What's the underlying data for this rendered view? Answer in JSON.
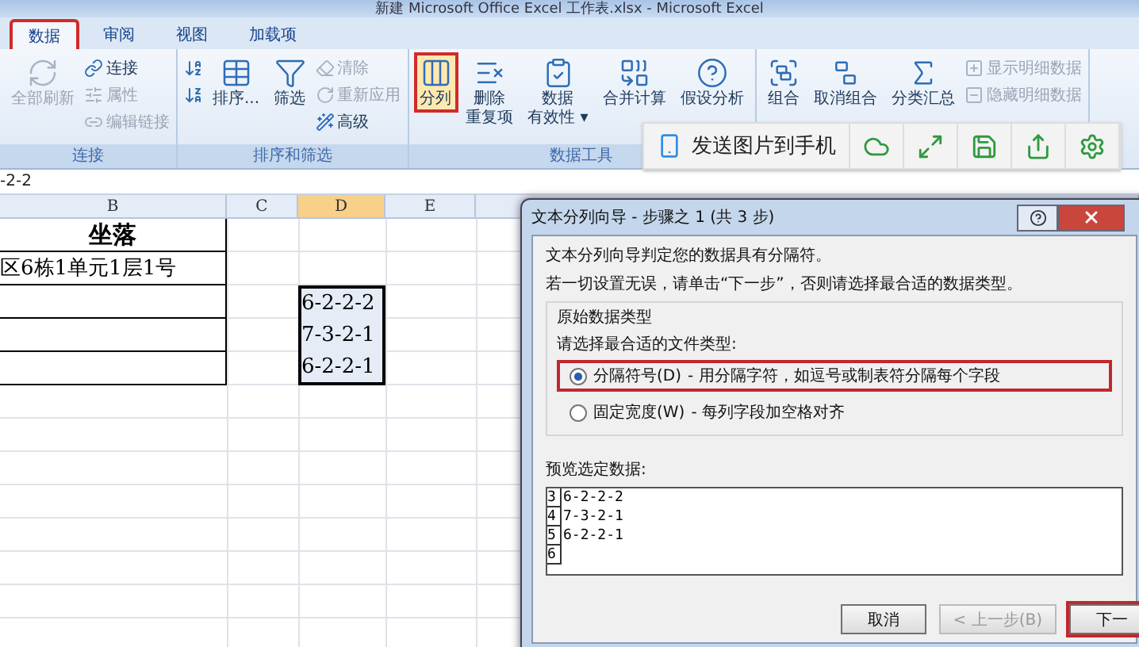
{
  "window": {
    "title": "新建 Microsoft Office Excel 工作表.xlsx - Microsoft Excel"
  },
  "ribbon_tabs": [
    {
      "label": "数据",
      "selected": true,
      "highlighted": true
    },
    {
      "label": "审阅",
      "selected": false,
      "highlighted": false
    },
    {
      "label": "视图",
      "selected": false,
      "highlighted": false
    },
    {
      "label": "加载项",
      "selected": false,
      "highlighted": false
    }
  ],
  "ribbon_groups": [
    {
      "label": "连接",
      "columns": [
        {
          "kind": "large",
          "lines": [
            "全部刷新"
          ],
          "disabled": true,
          "highlighted": false
        },
        {
          "kind": "stack",
          "items": [
            {
              "label": "连接",
              "disabled": false
            },
            {
              "label": "属性",
              "disabled": true
            },
            {
              "label": "编辑链接",
              "disabled": true
            }
          ]
        }
      ]
    },
    {
      "label": "排序和筛选",
      "columns": [
        {
          "kind": "stack",
          "items": [
            {
              "disabled": false
            },
            {
              "disabled": false
            }
          ]
        },
        {
          "kind": "large",
          "lines": [
            "排序..."
          ],
          "disabled": false,
          "highlighted": false
        },
        {
          "kind": "large",
          "lines": [
            "筛选"
          ],
          "disabled": false,
          "highlighted": false
        },
        {
          "kind": "stack",
          "items": [
            {
              "label": "清除",
              "disabled": true
            },
            {
              "label": "重新应用",
              "disabled": true
            },
            {
              "label": "高级",
              "disabled": false
            }
          ]
        }
      ]
    },
    {
      "label": "数据工具",
      "columns": [
        {
          "kind": "large",
          "lines": [
            "分列"
          ],
          "disabled": false,
          "highlighted": true
        },
        {
          "kind": "large",
          "lines": [
            "删除",
            "重复项"
          ],
          "disabled": false,
          "highlighted": false
        },
        {
          "kind": "large",
          "lines": [
            "数据",
            "有效性 ▾"
          ],
          "disabled": false,
          "highlighted": false
        },
        {
          "kind": "large",
          "lines": [
            "合并计算"
          ],
          "disabled": false,
          "highlighted": false
        },
        {
          "kind": "large",
          "lines": [
            "假设分析"
          ],
          "disabled": false,
          "highlighted": false
        }
      ]
    },
    {
      "columns": [
        {
          "kind": "large",
          "lines": [
            "组合"
          ],
          "disabled": false,
          "highlighted": false
        },
        {
          "kind": "large",
          "lines": [
            "取消组合"
          ],
          "disabled": false,
          "highlighted": false
        },
        {
          "kind": "large",
          "lines": [
            "分类汇总"
          ],
          "disabled": false,
          "highlighted": false
        },
        {
          "kind": "stack",
          "items": [
            {
              "label": "显示明细数据",
              "disabled": true
            },
            {
              "label": "隐藏明细数据",
              "disabled": true
            }
          ]
        }
      ]
    }
  ],
  "float_toolbar": {
    "label": "发送图片到手机"
  },
  "formula_bar": {
    "value": "-2-2"
  },
  "sheet": {
    "columns": [
      {
        "label": "B",
        "selected": false
      },
      {
        "label": "C",
        "selected": false
      },
      {
        "label": "D",
        "selected": true
      },
      {
        "label": "E",
        "selected": false
      }
    ],
    "rows": [
      {
        "cells": [
          {
            "text": "坐落",
            "selected": false
          },
          {
            "selected": false
          },
          {
            "selected": false
          },
          {
            "selected": false
          }
        ]
      },
      {
        "cells": [
          {
            "text": "区6栋1单元1层1号",
            "selected": false
          },
          {
            "selected": false
          },
          {
            "selected": false
          },
          {
            "selected": false
          }
        ]
      },
      {
        "cells": [
          {
            "selected": false
          },
          {
            "selected": false
          },
          {
            "text": "6-2-2-2",
            "selected": true
          },
          {
            "selected": false
          }
        ]
      },
      {
        "cells": [
          {
            "selected": false
          },
          {
            "selected": false
          },
          {
            "text": "7-3-2-1",
            "selected": true
          },
          {
            "selected": false
          }
        ]
      },
      {
        "cells": [
          {
            "selected": false
          },
          {
            "selected": false
          },
          {
            "text": "6-2-2-1",
            "selected": true
          },
          {
            "selected": false
          }
        ]
      }
    ]
  },
  "dialog": {
    "title": "文本分列向导 - 步骤之 1 (共 3 步)",
    "intro": [
      "文本分列向导判定您的数据具有分隔符。",
      "若一切设置无误，请单击“下一步”，否则请选择最合适的数据类型。"
    ],
    "group_label": "原始数据类型",
    "prompt": "请选择最合适的文件类型:",
    "options": [
      {
        "label": "分隔符号(D)",
        "description": "- 用分隔字符，如逗号或制表符分隔每个字段",
        "selected": true,
        "highlighted": true
      },
      {
        "label": "固定宽度(W)",
        "description": "- 每列字段加空格对齐",
        "selected": false,
        "highlighted": false
      }
    ],
    "preview_label": "预览选定数据:",
    "preview_rows": [
      {
        "number": "3",
        "text": "6-2-2-2"
      },
      {
        "number": "4",
        "text": "7-3-2-1"
      },
      {
        "number": "5",
        "text": "6-2-2-1"
      },
      {
        "number": "6"
      }
    ],
    "buttons": [
      {
        "label": "取消",
        "disabled": false,
        "highlighted": false
      },
      {
        "label": "< 上一步(B)",
        "disabled": true,
        "highlighted": false
      },
      {
        "label": "下一",
        "disabled": false,
        "highlighted": true
      }
    ]
  }
}
